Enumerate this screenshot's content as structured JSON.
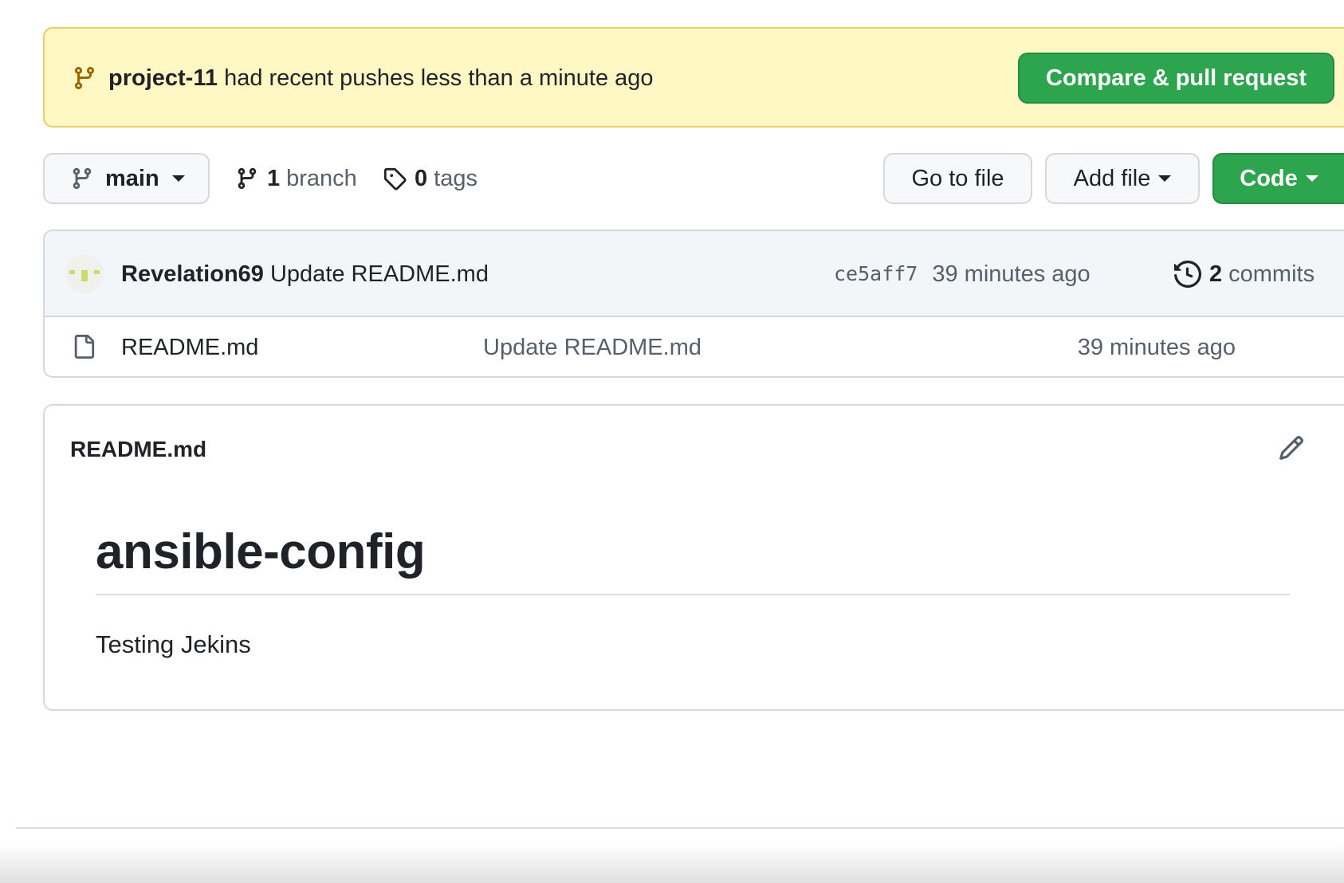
{
  "banner": {
    "branch_name": "project-11",
    "message": "had recent pushes less than a minute ago",
    "compare_label": "Compare & pull request"
  },
  "toolbar": {
    "current_branch": "main",
    "branch_count": "1",
    "branch_label": "branch",
    "tag_count": "0",
    "tag_label": "tags",
    "goto_file_label": "Go to file",
    "add_file_label": "Add file",
    "code_label": "Code"
  },
  "latest_commit": {
    "author": "Revelation69",
    "message": "Update README.md",
    "sha": "ce5aff7",
    "age": "39 minutes ago",
    "commit_count": "2",
    "commits_label": "commits"
  },
  "files": [
    {
      "name": "README.md",
      "message": "Update README.md",
      "age": "39 minutes ago",
      "icon": "file-icon"
    }
  ],
  "readme": {
    "title": "README.md",
    "heading": "ansible-config",
    "body": "Testing Jekins"
  },
  "colors": {
    "banner_bg": "#fff8c5",
    "primary_green": "#2da44e",
    "muted_text": "#57606a"
  }
}
